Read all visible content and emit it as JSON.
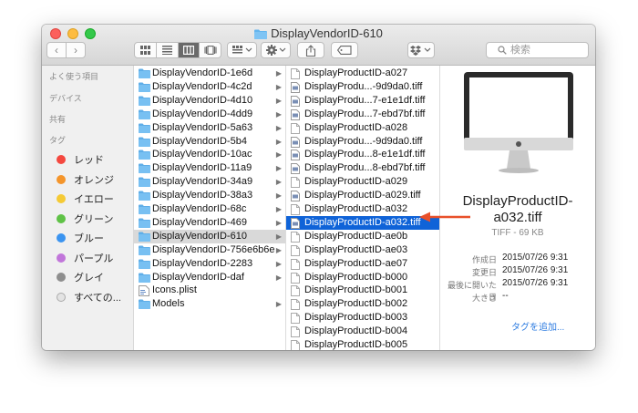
{
  "window": {
    "title": "DisplayVendorID-610"
  },
  "toolbar": {
    "back_glyph": "‹",
    "forward_glyph": "›",
    "search_placeholder": "検索",
    "view_modes": [
      "icon-view",
      "list-view",
      "column-view",
      "coverflow-view"
    ],
    "active_view": "column-view"
  },
  "sidebar": {
    "favorites_header": "よく使う項目",
    "devices_header": "デバイス",
    "shared_header": "共有",
    "tags_header": "タグ",
    "tags": [
      {
        "label": "レッド",
        "color": "#f4483f"
      },
      {
        "label": "オレンジ",
        "color": "#f4952b"
      },
      {
        "label": "イエロー",
        "color": "#f5ca35"
      },
      {
        "label": "グリーン",
        "color": "#5fc246"
      },
      {
        "label": "ブルー",
        "color": "#3b94f0"
      },
      {
        "label": "パープル",
        "color": "#c176da"
      },
      {
        "label": "グレイ",
        "color": "#8e8e8e"
      },
      {
        "label": "すべての...",
        "color": "#e3e3e3"
      }
    ]
  },
  "column1": {
    "items": [
      {
        "name": "DisplayVendorID-1e6d",
        "kind": "folder"
      },
      {
        "name": "DisplayVendorID-4c2d",
        "kind": "folder"
      },
      {
        "name": "DisplayVendorID-4d10",
        "kind": "folder"
      },
      {
        "name": "DisplayVendorID-4dd9",
        "kind": "folder"
      },
      {
        "name": "DisplayVendorID-5a63",
        "kind": "folder"
      },
      {
        "name": "DisplayVendorID-5b4",
        "kind": "folder"
      },
      {
        "name": "DisplayVendorID-10ac",
        "kind": "folder"
      },
      {
        "name": "DisplayVendorID-11a9",
        "kind": "folder"
      },
      {
        "name": "DisplayVendorID-34a9",
        "kind": "folder"
      },
      {
        "name": "DisplayVendorID-38a3",
        "kind": "folder"
      },
      {
        "name": "DisplayVendorID-68c",
        "kind": "folder"
      },
      {
        "name": "DisplayVendorID-469",
        "kind": "folder"
      },
      {
        "name": "DisplayVendorID-610",
        "kind": "folder",
        "selected": true
      },
      {
        "name": "DisplayVendorID-756e6b6e",
        "kind": "folder"
      },
      {
        "name": "DisplayVendorID-2283",
        "kind": "folder"
      },
      {
        "name": "DisplayVendorID-daf",
        "kind": "folder"
      },
      {
        "name": "Icons.plist",
        "kind": "plist"
      },
      {
        "name": "Models",
        "kind": "folder"
      }
    ]
  },
  "column2": {
    "items": [
      {
        "name": "DisplayProductID-a027",
        "kind": "doc"
      },
      {
        "name": "DisplayProdu...-9d9da0.tiff",
        "kind": "tiff"
      },
      {
        "name": "DisplayProdu...7-e1e1df.tiff",
        "kind": "tiff"
      },
      {
        "name": "DisplayProdu...7-ebd7bf.tiff",
        "kind": "tiff"
      },
      {
        "name": "DisplayProductID-a028",
        "kind": "doc"
      },
      {
        "name": "DisplayProdu...-9d9da0.tiff",
        "kind": "tiff"
      },
      {
        "name": "DisplayProdu...8-e1e1df.tiff",
        "kind": "tiff"
      },
      {
        "name": "DisplayProdu...8-ebd7bf.tiff",
        "kind": "tiff"
      },
      {
        "name": "DisplayProductID-a029",
        "kind": "doc"
      },
      {
        "name": "DisplayProductID-a029.tiff",
        "kind": "tiff"
      },
      {
        "name": "DisplayProductID-a032",
        "kind": "doc"
      },
      {
        "name": "DisplayProductID-a032.tiff",
        "kind": "tiff",
        "selected": true
      },
      {
        "name": "DisplayProductID-ae0b",
        "kind": "doc"
      },
      {
        "name": "DisplayProductID-ae03",
        "kind": "doc"
      },
      {
        "name": "DisplayProductID-ae07",
        "kind": "doc"
      },
      {
        "name": "DisplayProductID-b000",
        "kind": "doc"
      },
      {
        "name": "DisplayProductID-b001",
        "kind": "doc"
      },
      {
        "name": "DisplayProductID-b002",
        "kind": "doc"
      },
      {
        "name": "DisplayProductID-b003",
        "kind": "doc"
      },
      {
        "name": "DisplayProductID-b004",
        "kind": "doc"
      },
      {
        "name": "DisplayProductID-b005",
        "kind": "doc"
      }
    ]
  },
  "preview": {
    "name_line1": "DisplayProductID-",
    "name_line2": "a032.tiff",
    "kind_size": "TIFF - 69 KB",
    "meta": [
      {
        "label": "作成日",
        "value": "2015/07/26 9:31"
      },
      {
        "label": "変更日",
        "value": "2015/07/26 9:31"
      },
      {
        "label": "最後に開いた日",
        "value": "2015/07/26 9:31"
      },
      {
        "label": "大きさ",
        "value": "--"
      }
    ],
    "add_tags": "タグを追加..."
  },
  "colors": {
    "selection_blue": "#0f63d8",
    "annotation_arrow": "#e8502a"
  }
}
